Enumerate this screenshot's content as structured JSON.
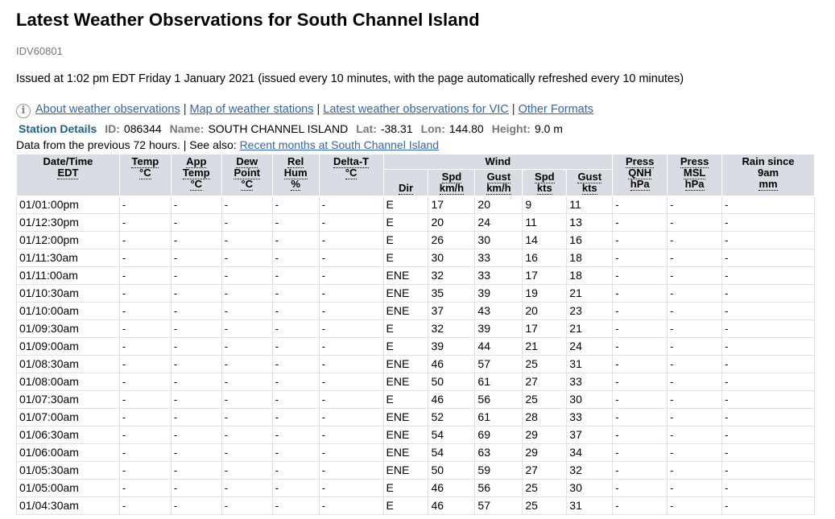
{
  "page": {
    "title": "Latest Weather Observations for South Channel Island",
    "product_id": "IDV60801",
    "issued": "Issued at 1:02 pm EDT Friday 1 January 2021 (issued every 10 minutes, with the page automatically refreshed every 10 minutes)"
  },
  "links": {
    "info_icon": "i",
    "about": "About weather observations",
    "map": "Map of weather stations",
    "latest_vic": "Latest weather observations for VIC",
    "other_formats": "Other Formats",
    "separator": "|"
  },
  "station": {
    "heading": "Station Details",
    "id_label": "ID:",
    "id": "086344",
    "name_label": "Name:",
    "name": "SOUTH CHANNEL ISLAND",
    "lat_label": "Lat:",
    "lat": "-38.31",
    "lon_label": "Lon:",
    "lon": "144.80",
    "height_label": "Height:",
    "height": "9.0 m"
  },
  "data_from": {
    "text": "Data from the previous 72 hours. | See also: ",
    "link": "Recent months at South Channel Island"
  },
  "table": {
    "headers": {
      "datetime": [
        "Date/Time",
        "EDT"
      ],
      "temp": [
        "Temp",
        "°C"
      ],
      "app_temp": [
        "App",
        "Temp",
        "°C"
      ],
      "dew_point": [
        "Dew",
        "Point",
        "°C"
      ],
      "rel_hum": [
        "Rel",
        "Hum",
        "%"
      ],
      "delta_t": [
        "Delta-T",
        "°C"
      ],
      "wind": "Wind",
      "dir": "Dir",
      "spd_kmh": [
        "Spd",
        "km/h"
      ],
      "gust_kmh": [
        "Gust",
        "km/h"
      ],
      "spd_kts": [
        "Spd",
        "kts"
      ],
      "gust_kts": [
        "Gust",
        "kts"
      ],
      "press_qnh": [
        "Press",
        "QNH",
        "hPa"
      ],
      "press_msl": [
        "Press",
        "MSL",
        "hPa"
      ],
      "rain": [
        "Rain since",
        "9am",
        "mm"
      ]
    },
    "rows": [
      [
        "01/01:00pm",
        "-",
        "-",
        "-",
        "-",
        "-",
        "E",
        "17",
        "20",
        "9",
        "11",
        "-",
        "-",
        "-"
      ],
      [
        "01/12:30pm",
        "-",
        "-",
        "-",
        "-",
        "-",
        "E",
        "20",
        "24",
        "11",
        "13",
        "-",
        "-",
        "-"
      ],
      [
        "01/12:00pm",
        "-",
        "-",
        "-",
        "-",
        "-",
        "E",
        "26",
        "30",
        "14",
        "16",
        "-",
        "-",
        "-"
      ],
      [
        "01/11:30am",
        "-",
        "-",
        "-",
        "-",
        "-",
        "E",
        "30",
        "33",
        "16",
        "18",
        "-",
        "-",
        "-"
      ],
      [
        "01/11:00am",
        "-",
        "-",
        "-",
        "-",
        "-",
        "ENE",
        "32",
        "33",
        "17",
        "18",
        "-",
        "-",
        "-"
      ],
      [
        "01/10:30am",
        "-",
        "-",
        "-",
        "-",
        "-",
        "ENE",
        "35",
        "39",
        "19",
        "21",
        "-",
        "-",
        "-"
      ],
      [
        "01/10:00am",
        "-",
        "-",
        "-",
        "-",
        "-",
        "ENE",
        "37",
        "43",
        "20",
        "23",
        "-",
        "-",
        "-"
      ],
      [
        "01/09:30am",
        "-",
        "-",
        "-",
        "-",
        "-",
        "E",
        "32",
        "39",
        "17",
        "21",
        "-",
        "-",
        "-"
      ],
      [
        "01/09:00am",
        "-",
        "-",
        "-",
        "-",
        "-",
        "E",
        "39",
        "44",
        "21",
        "24",
        "-",
        "-",
        "-"
      ],
      [
        "01/08:30am",
        "-",
        "-",
        "-",
        "-",
        "-",
        "ENE",
        "46",
        "57",
        "25",
        "31",
        "-",
        "-",
        "-"
      ],
      [
        "01/08:00am",
        "-",
        "-",
        "-",
        "-",
        "-",
        "ENE",
        "50",
        "61",
        "27",
        "33",
        "-",
        "-",
        "-"
      ],
      [
        "01/07:30am",
        "-",
        "-",
        "-",
        "-",
        "-",
        "E",
        "46",
        "56",
        "25",
        "30",
        "-",
        "-",
        "-"
      ],
      [
        "01/07:00am",
        "-",
        "-",
        "-",
        "-",
        "-",
        "ENE",
        "52",
        "61",
        "28",
        "33",
        "-",
        "-",
        "-"
      ],
      [
        "01/06:30am",
        "-",
        "-",
        "-",
        "-",
        "-",
        "ENE",
        "54",
        "69",
        "29",
        "37",
        "-",
        "-",
        "-"
      ],
      [
        "01/06:00am",
        "-",
        "-",
        "-",
        "-",
        "-",
        "ENE",
        "54",
        "63",
        "29",
        "34",
        "-",
        "-",
        "-"
      ],
      [
        "01/05:30am",
        "-",
        "-",
        "-",
        "-",
        "-",
        "ENE",
        "50",
        "59",
        "27",
        "32",
        "-",
        "-",
        "-"
      ],
      [
        "01/05:00am",
        "-",
        "-",
        "-",
        "-",
        "-",
        "E",
        "46",
        "56",
        "25",
        "30",
        "-",
        "-",
        "-"
      ],
      [
        "01/04:30am",
        "-",
        "-",
        "-",
        "-",
        "-",
        "E",
        "46",
        "57",
        "25",
        "31",
        "-",
        "-",
        "-"
      ]
    ]
  },
  "colors": {
    "link": "#3366aa",
    "station_heading": "#1f5f8b",
    "header_bg": "#d7dde3",
    "label_grey": "#777777"
  }
}
